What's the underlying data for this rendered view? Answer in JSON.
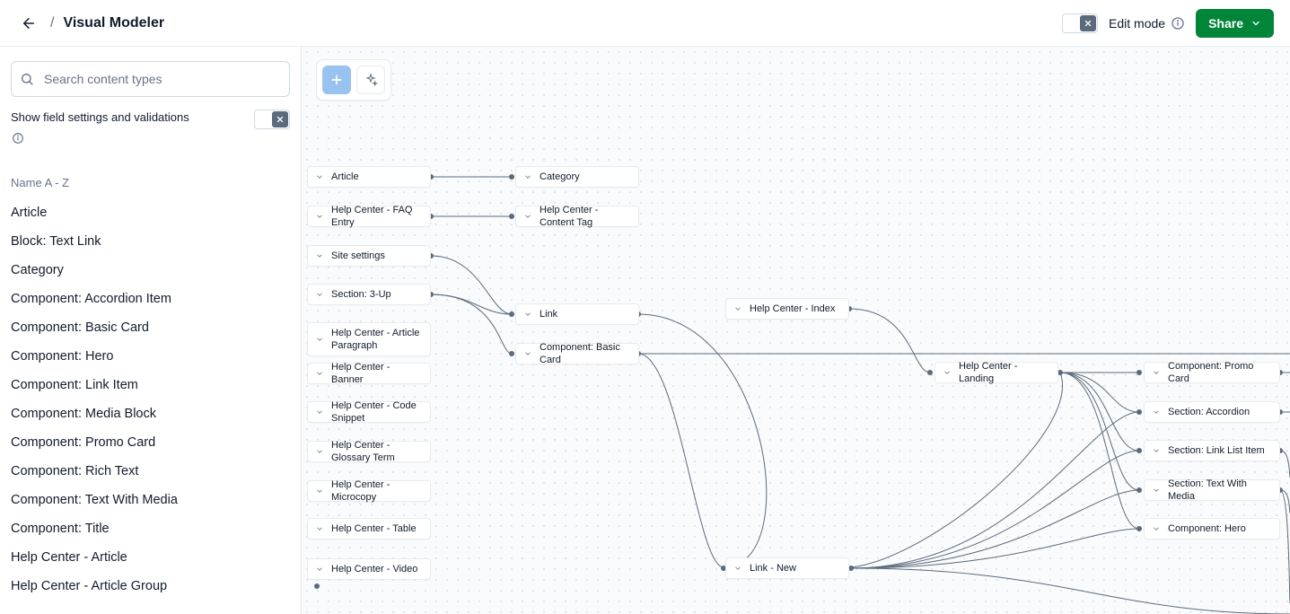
{
  "header": {
    "title": "Visual Modeler",
    "edit_mode_label": "Edit mode",
    "share_label": "Share"
  },
  "sidebar": {
    "search_placeholder": "Search content types",
    "show_fields_label": "Show field settings and validations",
    "sort_label": "Name A - Z",
    "content_types": [
      "Article",
      "Block: Text Link",
      "Category",
      "Component: Accordion Item",
      "Component: Basic Card",
      "Component: Hero",
      "Component: Link Item",
      "Component: Media Block",
      "Component: Promo Card",
      "Component: Rich Text",
      "Component: Text With Media",
      "Component: Title",
      "Help Center - Article",
      "Help Center - Article Group"
    ]
  },
  "toolbar": {
    "add_icon": "plus-icon",
    "magic_icon": "sparkle-icon"
  },
  "nodes": {
    "article": "Article",
    "category": "Category",
    "faq_entry": "Help Center - FAQ Entry",
    "content_tag": "Help Center - Content Tag",
    "site_settings": "Site settings",
    "section_3up": "Section: 3-Up",
    "article_paragraph": "Help Center - Article Paragraph",
    "banner": "Help Center - Banner",
    "code_snippet": "Help Center - Code Snippet",
    "glossary_term": "Help Center - Glossary Term",
    "microcopy": "Help Center - Microcopy",
    "table": "Help Center - Table",
    "video": "Help Center - Video",
    "link": "Link",
    "basic_card": "Component: Basic Card",
    "hc_index": "Help Center - Index",
    "hc_landing": "Help Center - Landing",
    "link_new": "Link - New",
    "promo_card": "Component: Promo Card",
    "section_accordion": "Section: Accordion",
    "section_linklist": "Section: Link List Item",
    "section_textmedia": "Section: Text With Media",
    "comp_hero": "Component: Hero"
  }
}
